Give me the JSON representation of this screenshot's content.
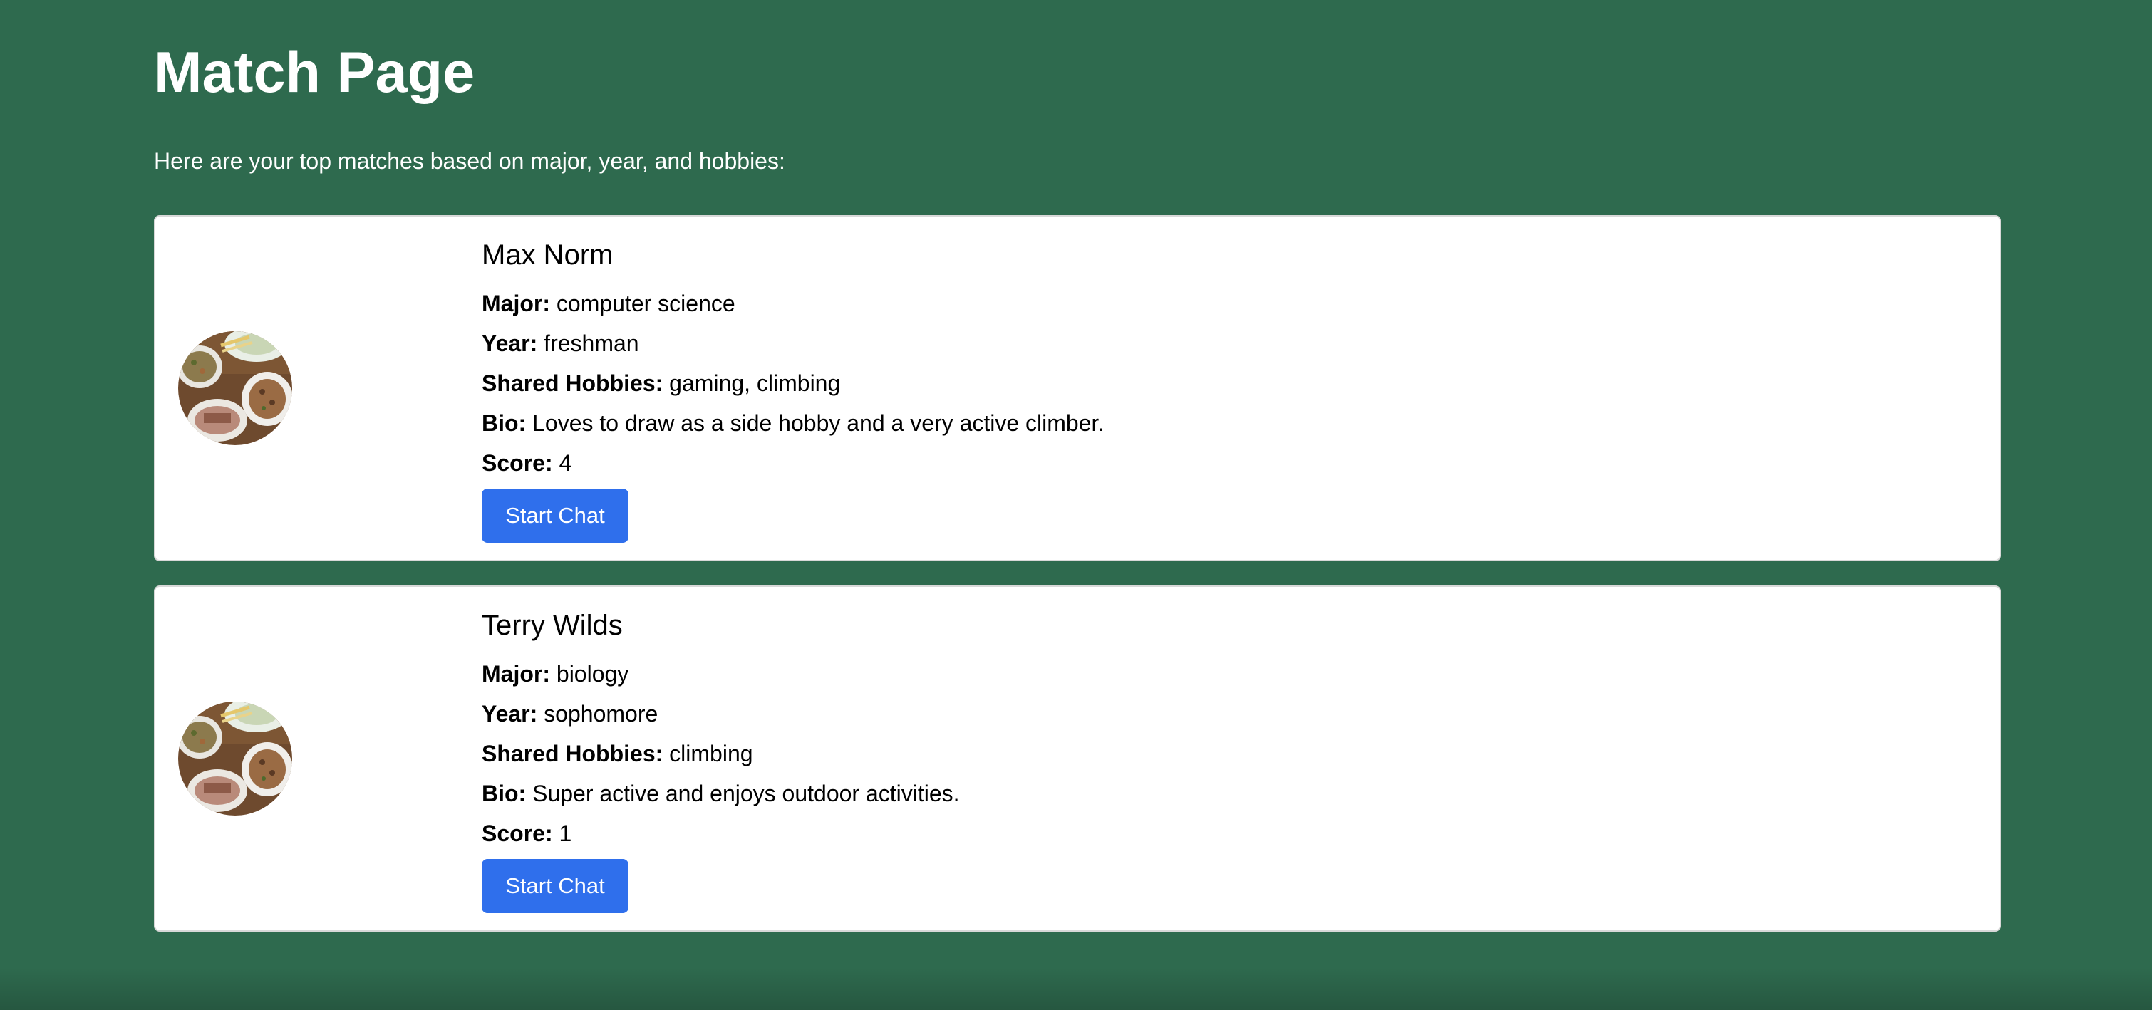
{
  "page": {
    "title": "Match Page",
    "intro": "Here are your top matches based on major, year, and hobbies:"
  },
  "labels": {
    "major": "Major:",
    "year": "Year:",
    "shared_hobbies": "Shared Hobbies:",
    "bio": "Bio:",
    "score": "Score:"
  },
  "matches": [
    {
      "name": "Max Norm",
      "major": "computer science",
      "year": "freshman",
      "shared_hobbies": "gaming, climbing",
      "bio": "Loves to draw as a side hobby and a very active climber.",
      "score": "4",
      "button_label": "Start Chat"
    },
    {
      "name": "Terry Wilds",
      "major": "biology",
      "year": "sophomore",
      "shared_hobbies": "climbing",
      "bio": "Super active and enjoys outdoor activities.",
      "score": "1",
      "button_label": "Start Chat"
    }
  ],
  "colors": {
    "background": "#2e6a4e",
    "card": "#ffffff",
    "button": "#2f6fec"
  }
}
